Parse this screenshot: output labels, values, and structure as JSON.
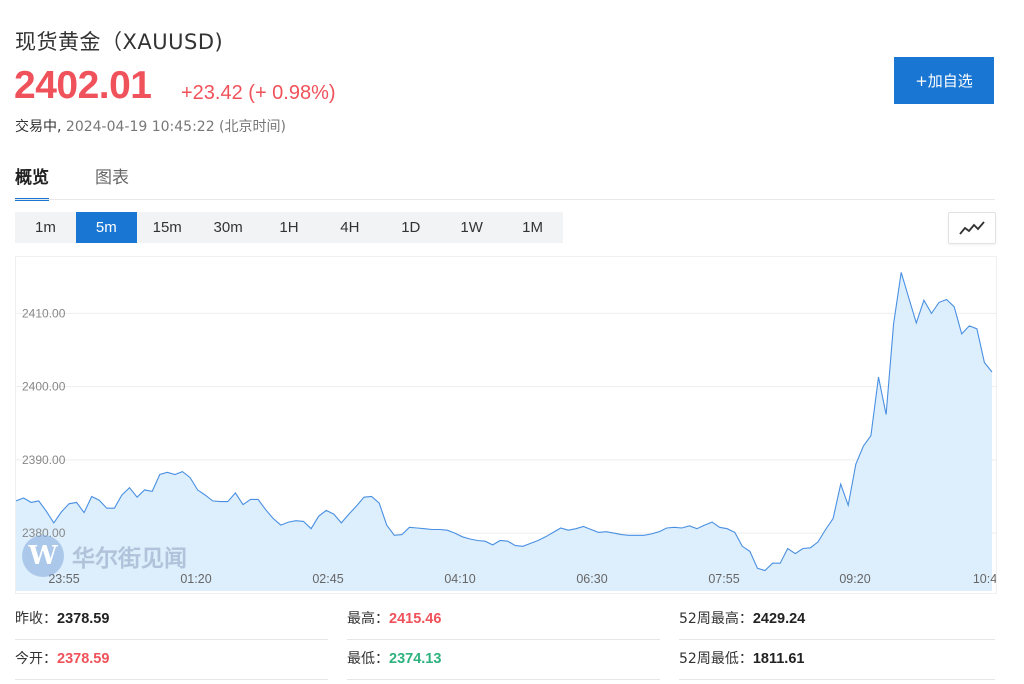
{
  "header": {
    "title": "现货黄金（XAUUSD)",
    "price": "2402.01",
    "change": "+23.42 (+ 0.98%)",
    "status_state": "交易中,",
    "status_time": "2024-04-19 10:45:22 (北京时间)",
    "add_button": "+加自选"
  },
  "tabs": [
    {
      "label": "概览",
      "active": true
    },
    {
      "label": "图表",
      "active": false
    }
  ],
  "periods": [
    {
      "label": "1m",
      "active": false
    },
    {
      "label": "5m",
      "active": true
    },
    {
      "label": "15m",
      "active": false
    },
    {
      "label": "30m",
      "active": false
    },
    {
      "label": "1H",
      "active": false
    },
    {
      "label": "4H",
      "active": false
    },
    {
      "label": "1D",
      "active": false
    },
    {
      "label": "1W",
      "active": false
    },
    {
      "label": "1M",
      "active": false
    }
  ],
  "chart_type_icon": "line-chart-icon",
  "watermark": {
    "letter": "W",
    "text": "华尔街见闻"
  },
  "chart_data": {
    "type": "area",
    "title": "",
    "xlabel": "",
    "ylabel": "",
    "ylim": [
      2372.1,
      2417.7
    ],
    "y_ticks": [
      "2380.00",
      "2390.00",
      "2400.00",
      "2410.00"
    ],
    "x_ticks": [
      "23:55",
      "01:20",
      "02:45",
      "04:10",
      "06:30",
      "07:55",
      "09:20",
      "10:4"
    ],
    "line_color": "#4a90e2",
    "fill_color": "#ddeefc",
    "series": [
      {
        "values": [
          2384.4,
          2384.8,
          2384.2,
          2384.4,
          2383.0,
          2381.4,
          2382.9,
          2384.0,
          2384.2,
          2382.8,
          2385.0,
          2384.5,
          2383.4,
          2383.4,
          2385.2,
          2386.2,
          2384.9,
          2385.9,
          2385.7,
          2388.0,
          2388.3,
          2388.0,
          2388.4,
          2387.6,
          2385.9,
          2385.2,
          2384.4,
          2384.3,
          2384.3,
          2385.5,
          2383.9,
          2384.6,
          2384.6,
          2383.2,
          2382.0,
          2381.1,
          2381.5,
          2381.7,
          2381.6,
          2380.6,
          2382.3,
          2383.1,
          2382.6,
          2381.4,
          2382.6,
          2383.7,
          2384.9,
          2385.0,
          2384.1,
          2381.1,
          2379.7,
          2379.8,
          2380.8,
          2380.7,
          2380.6,
          2380.5,
          2380.5,
          2380.4,
          2380.0,
          2379.5,
          2379.2,
          2379.0,
          2378.9,
          2378.4,
          2379.0,
          2378.9,
          2378.3,
          2378.2,
          2378.6,
          2379.0,
          2379.5,
          2380.1,
          2380.7,
          2380.4,
          2380.6,
          2380.9,
          2380.5,
          2380.1,
          2380.2,
          2380.0,
          2379.8,
          2379.7,
          2379.7,
          2379.7,
          2379.9,
          2380.2,
          2380.7,
          2380.8,
          2380.7,
          2381.0,
          2380.6,
          2381.1,
          2381.5,
          2380.8,
          2380.6,
          2380.1,
          2378.2,
          2377.5,
          2375.2,
          2374.9,
          2375.9,
          2375.9,
          2377.9,
          2377.2,
          2377.9,
          2378.0,
          2378.8,
          2380.5,
          2382.0,
          2386.7,
          2383.8,
          2389.4,
          2391.9,
          2393.3,
          2401.3,
          2396.2,
          2408.6,
          2415.6,
          2412.1,
          2408.7,
          2411.8,
          2410.0,
          2411.5,
          2411.9,
          2410.9,
          2407.2,
          2408.3,
          2407.9,
          2403.3,
          2402.0
        ]
      }
    ]
  },
  "stats": [
    {
      "label": "昨收：",
      "value": "2378.59",
      "color": "dark"
    },
    {
      "label": "最高：",
      "value": "2415.46",
      "color": "red"
    },
    {
      "label": "52周最高：",
      "value": "2429.24",
      "color": "dark"
    },
    {
      "label": "今开：",
      "value": "2378.59",
      "color": "red"
    },
    {
      "label": "最低：",
      "value": "2374.13",
      "color": "green"
    },
    {
      "label": "52周最低：",
      "value": "1811.61",
      "color": "dark"
    }
  ]
}
